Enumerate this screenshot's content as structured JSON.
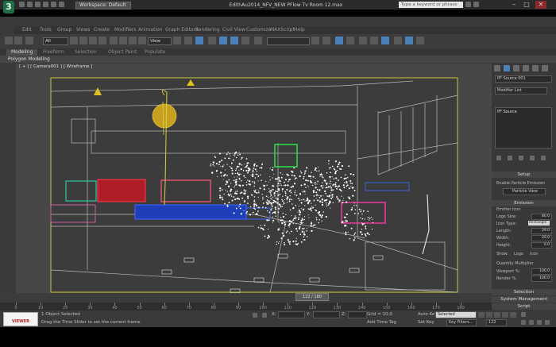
{
  "titlebar": {
    "logo": "3",
    "workspace": "Workspace: Default",
    "document_title": "EdithAu2014_NFV_NEW PFlow Tv Room 12.max",
    "search_placeholder": "Type a keyword or phrase",
    "minimize": "–",
    "maximize": "□",
    "close": "✕"
  },
  "menubar": {
    "items": [
      "Edit",
      "Tools",
      "Group",
      "Views",
      "Create",
      "Modifiers",
      "Animation",
      "Graph Editors",
      "Rendering",
      "Civil View",
      "Customize",
      "MAXScript",
      "Help"
    ]
  },
  "toolbar": {
    "selection_filter": "All",
    "view_dropdown": "View",
    "named_selection": ""
  },
  "ribbon": {
    "tabs": [
      "Modeling",
      "Freeform",
      "Selection",
      "Object Paint",
      "Populate"
    ],
    "active_tab": "Modeling",
    "subpanel": "Polygon Modeling"
  },
  "viewport": {
    "label": "[ + ] [ Camera001 ] [ Wireframe ]"
  },
  "command_panel": {
    "object_name": "PF Source 001",
    "modifier_list": "Modifier List",
    "stack_item": "PF Source",
    "sections": {
      "setup": "Setup",
      "enable": "Enable Particle Emission",
      "particle_view": "Particle View",
      "emission": "Emission",
      "emitter_icon": "Emitter Icon",
      "logo_size": "Logo Size:",
      "logo_size_val": "80.0",
      "icon_type": "Icon Type:",
      "icon_type_val": "Rectangle",
      "length": "Length:",
      "length_val": "29.0",
      "width": "Width:",
      "width_val": "20.0",
      "height": "Height:",
      "height_val": "0.0",
      "show": "Show:",
      "logo": "Logo",
      "icon": "Icon",
      "quantity_multiplier": "Quantity Multiplier",
      "viewport_pct": "Viewport %:",
      "viewport_val": "100.0",
      "render_pct": "Render %:",
      "render_val": "100.0",
      "selection": "Selection",
      "system_management": "System Management",
      "script": "Script"
    }
  },
  "timeline": {
    "current": "122 / 180",
    "ticks": [
      "0",
      "10",
      "20",
      "30",
      "40",
      "50",
      "60",
      "70",
      "80",
      "90",
      "100",
      "110",
      "120",
      "130",
      "140",
      "150",
      "160",
      "170",
      "180"
    ]
  },
  "statusbar": {
    "logo_text": "VIEWER",
    "selected": "1 Object Selected",
    "prompt": "Drag the Time Slider to set the current frame",
    "x": "X:",
    "y": "Y:",
    "z": "Z:",
    "grid": "Grid = 10.0",
    "add_time_tag": "Add Time Tag",
    "auto_key": "Auto Key",
    "selected_dropdown": "Selected",
    "set_key": "Set Key",
    "key_filters": "Key Filters...",
    "frame": "122"
  },
  "colors": {
    "accent": "#4a82b8",
    "viewport_bg": "#474747",
    "wire_yellow": "#c8c43a",
    "wire_white": "#cfcfcf"
  }
}
